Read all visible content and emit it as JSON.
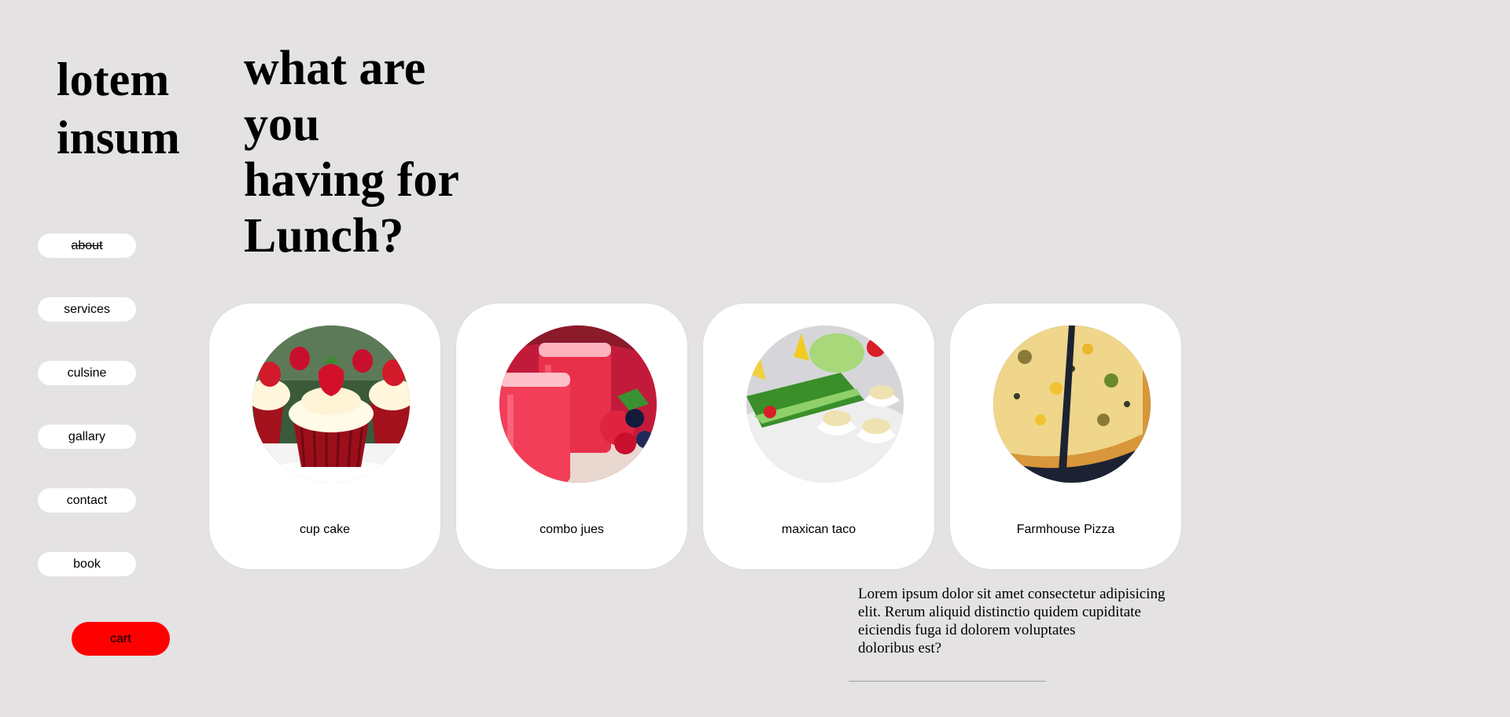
{
  "brand": {
    "line1": "lotem",
    "line2": "insum"
  },
  "headline": {
    "line1": "what are",
    "line2": "you",
    "line3": "having for",
    "line4": "Lunch?"
  },
  "nav": {
    "items": [
      {
        "label": "about"
      },
      {
        "label": "services"
      },
      {
        "label": "culsine"
      },
      {
        "label": "gallary"
      },
      {
        "label": "contact"
      },
      {
        "label": "book"
      }
    ]
  },
  "cart": {
    "label": "cart",
    "color": "#ff0000"
  },
  "cards": [
    {
      "label": "cup cake",
      "image": "cupcakes-photo"
    },
    {
      "label": "combo jues",
      "image": "juice-photo"
    },
    {
      "label": "maxican taco",
      "image": "taco-photo"
    },
    {
      "label": "Farmhouse Pizza",
      "image": "pizza-photo"
    }
  ],
  "blurb": {
    "line1": "Lorem ipsum dolor sit amet consectetur adipisicing",
    "line2": "elit. Rerum aliquid distinctio quidem cupiditate",
    "line3": "eiciendis fuga id dolorem voluptates",
    "line4": "doloribus est?"
  },
  "colors": {
    "background": "#e4e2e3",
    "card": "#ffffff",
    "accent": "#ff0000"
  }
}
